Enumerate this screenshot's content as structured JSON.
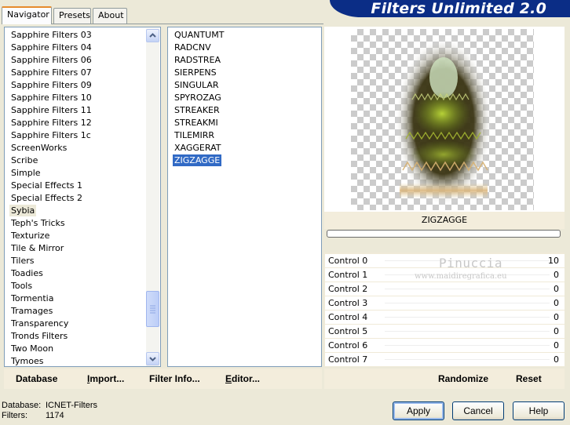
{
  "tabs": [
    "Navigator",
    "Presets",
    "About"
  ],
  "title": "Filters Unlimited 2.0",
  "categories": [
    "Sapphire Filters 03",
    "Sapphire Filters 04",
    "Sapphire Filters 06",
    "Sapphire Filters 07",
    "Sapphire Filters 09",
    "Sapphire Filters 10",
    "Sapphire Filters 11",
    "Sapphire Filters 12",
    "Sapphire Filters 1c",
    "ScreenWorks",
    "Scribe",
    "Simple",
    "Special Effects 1",
    "Special Effects 2",
    "Sybia",
    "Teph's Tricks",
    "Texturize",
    "Tile & Mirror",
    "Tilers",
    "Toadies",
    "Tools",
    "Tormentia",
    "Tramages",
    "Transparency",
    "Tronds Filters",
    "Two Moon",
    "Tymoes"
  ],
  "selected_category": "Sybia",
  "filters": [
    "QUANTUMT",
    "RADCNV",
    "RADSTREA",
    "SIERPENS",
    "SINGULAR",
    "SPYROZAG",
    "STREAKER",
    "STREAKMI",
    "TILEMIRR",
    "XAGGERAT",
    "ZIGZAGGE"
  ],
  "selected_filter": "ZIGZAGGE",
  "preview": {
    "filter_name": "ZIGZAGGE",
    "progress_fraction": 0
  },
  "controls": [
    {
      "label": "Control 0",
      "value": "10"
    },
    {
      "label": "Control 1",
      "value": "0"
    },
    {
      "label": "Control 2",
      "value": "0"
    },
    {
      "label": "Control 3",
      "value": "0"
    },
    {
      "label": "Control 4",
      "value": "0"
    },
    {
      "label": "Control 5",
      "value": "0"
    },
    {
      "label": "Control 6",
      "value": "0"
    },
    {
      "label": "Control 7",
      "value": "0"
    }
  ],
  "watermark": {
    "line1": "Pinuccia",
    "line2": "www.maidiregrafica.eu"
  },
  "links": {
    "database": "Database",
    "import_u": "I",
    "import_rest": "mport...",
    "filter_info": "Filter Info...",
    "editor_u": "E",
    "editor_rest": "ditor...",
    "randomize": "Randomize",
    "reset": "Reset"
  },
  "status": {
    "database_label": "Database:",
    "database_value": "ICNET-Filters",
    "filters_label": "Filters:",
    "filters_value": "1174"
  },
  "buttons": {
    "apply": "Apply",
    "cancel": "Cancel",
    "help": "Help"
  },
  "colors": {
    "banner": "#0b2d86",
    "selection": "#316ac5",
    "tab_accent": "#e68b2c"
  }
}
